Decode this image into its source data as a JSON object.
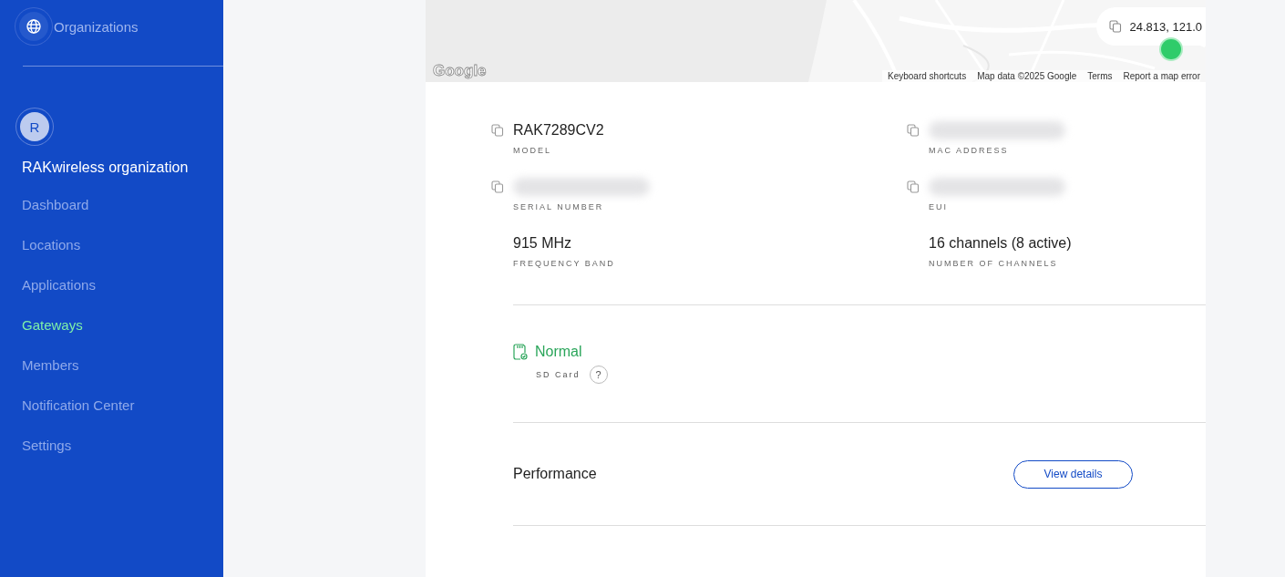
{
  "sidebar": {
    "header": "Organizations",
    "org": {
      "initial": "R",
      "name": "RAKwireless organization"
    },
    "items": [
      {
        "label": "Dashboard",
        "selected": false
      },
      {
        "label": "Locations",
        "selected": false
      },
      {
        "label": "Applications",
        "selected": false
      },
      {
        "label": "Gateways",
        "selected": true
      },
      {
        "label": "Members",
        "selected": false
      },
      {
        "label": "Notification Center",
        "selected": false
      },
      {
        "label": "Settings",
        "selected": false
      }
    ]
  },
  "map": {
    "kind": "picture",
    "coordinates": "24.813, 121.0",
    "logo": "Google",
    "attribution": [
      "Keyboard shortcuts",
      "Map data ©2025 Google",
      "Terms",
      "Report a map error"
    ]
  },
  "details": [
    {
      "value": "RAK7289CV2",
      "label": "MODEL",
      "copyable": true,
      "redacted": false
    },
    {
      "label": "MAC ADDRESS",
      "copyable": true,
      "redacted": true
    },
    {
      "label": "SERIAL NUMBER",
      "copyable": true,
      "redacted": true
    },
    {
      "label": "EUI",
      "copyable": true,
      "redacted": true
    },
    {
      "value": "915 MHz",
      "label": "FREQUENCY BAND",
      "copyable": false,
      "redacted": false
    },
    {
      "value": "16 channels (8 active)",
      "label": "NUMBER OF CHANNELS",
      "copyable": false,
      "redacted": false
    }
  ],
  "sd_card": {
    "status": "Normal",
    "label": "SD Card",
    "help": "?"
  },
  "performance": {
    "title": "Performance",
    "button": "View details"
  }
}
